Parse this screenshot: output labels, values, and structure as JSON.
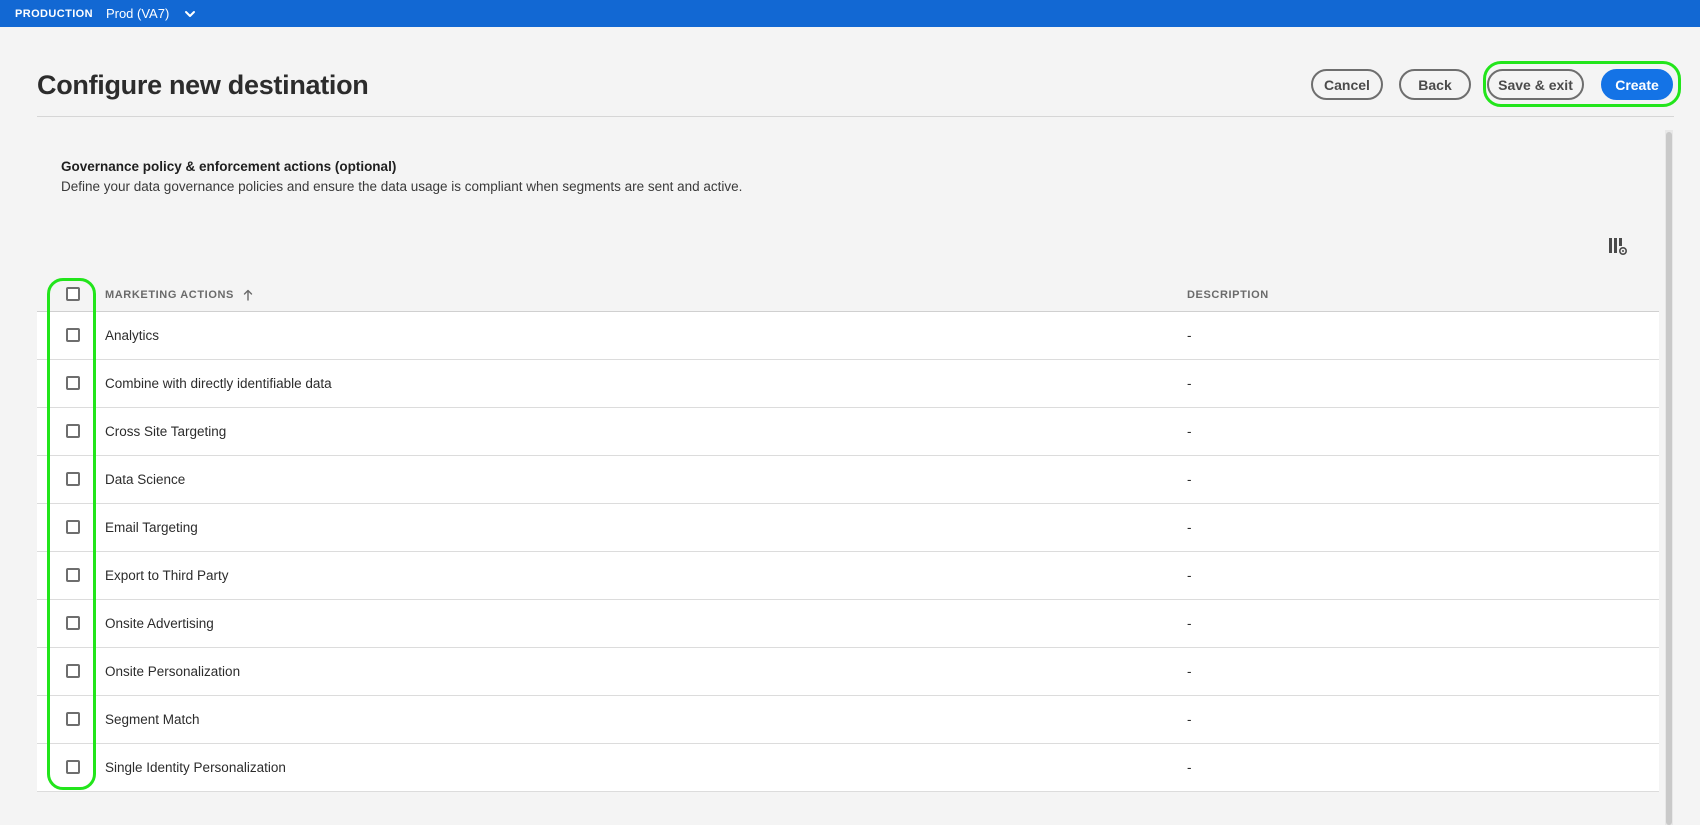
{
  "topbar": {
    "environment_label": "PRODUCTION",
    "sandbox_name": "Prod (VA7)"
  },
  "header": {
    "title": "Configure new destination",
    "buttons": {
      "cancel": "Cancel",
      "back": "Back",
      "save_exit": "Save & exit",
      "create": "Create"
    }
  },
  "section": {
    "title": "Governance policy & enforcement actions (optional)",
    "description": "Define your data governance policies and ensure the data usage is compliant when segments are sent and active."
  },
  "table": {
    "columns": {
      "actions": "MARKETING ACTIONS",
      "description": "DESCRIPTION"
    },
    "sort": "ascending",
    "rows": [
      {
        "name": "Analytics",
        "description": "-",
        "checked": false
      },
      {
        "name": "Combine with directly identifiable data",
        "description": "-",
        "checked": false
      },
      {
        "name": "Cross Site Targeting",
        "description": "-",
        "checked": false
      },
      {
        "name": "Data Science",
        "description": "-",
        "checked": false
      },
      {
        "name": "Email Targeting",
        "description": "-",
        "checked": false
      },
      {
        "name": "Export to Third Party",
        "description": "-",
        "checked": false
      },
      {
        "name": "Onsite Advertising",
        "description": "-",
        "checked": false
      },
      {
        "name": "Onsite Personalization",
        "description": "-",
        "checked": false
      },
      {
        "name": "Segment Match",
        "description": "-",
        "checked": false
      },
      {
        "name": "Single Identity Personalization",
        "description": "-",
        "checked": false
      }
    ]
  },
  "colors": {
    "topbar": "#1268d3",
    "primary_button": "#1473e6",
    "highlight": "#22e51b",
    "background": "#f4f4f4"
  },
  "icons": [
    "chevron-down-icon",
    "sort-ascending-icon",
    "column-settings-icon"
  ]
}
